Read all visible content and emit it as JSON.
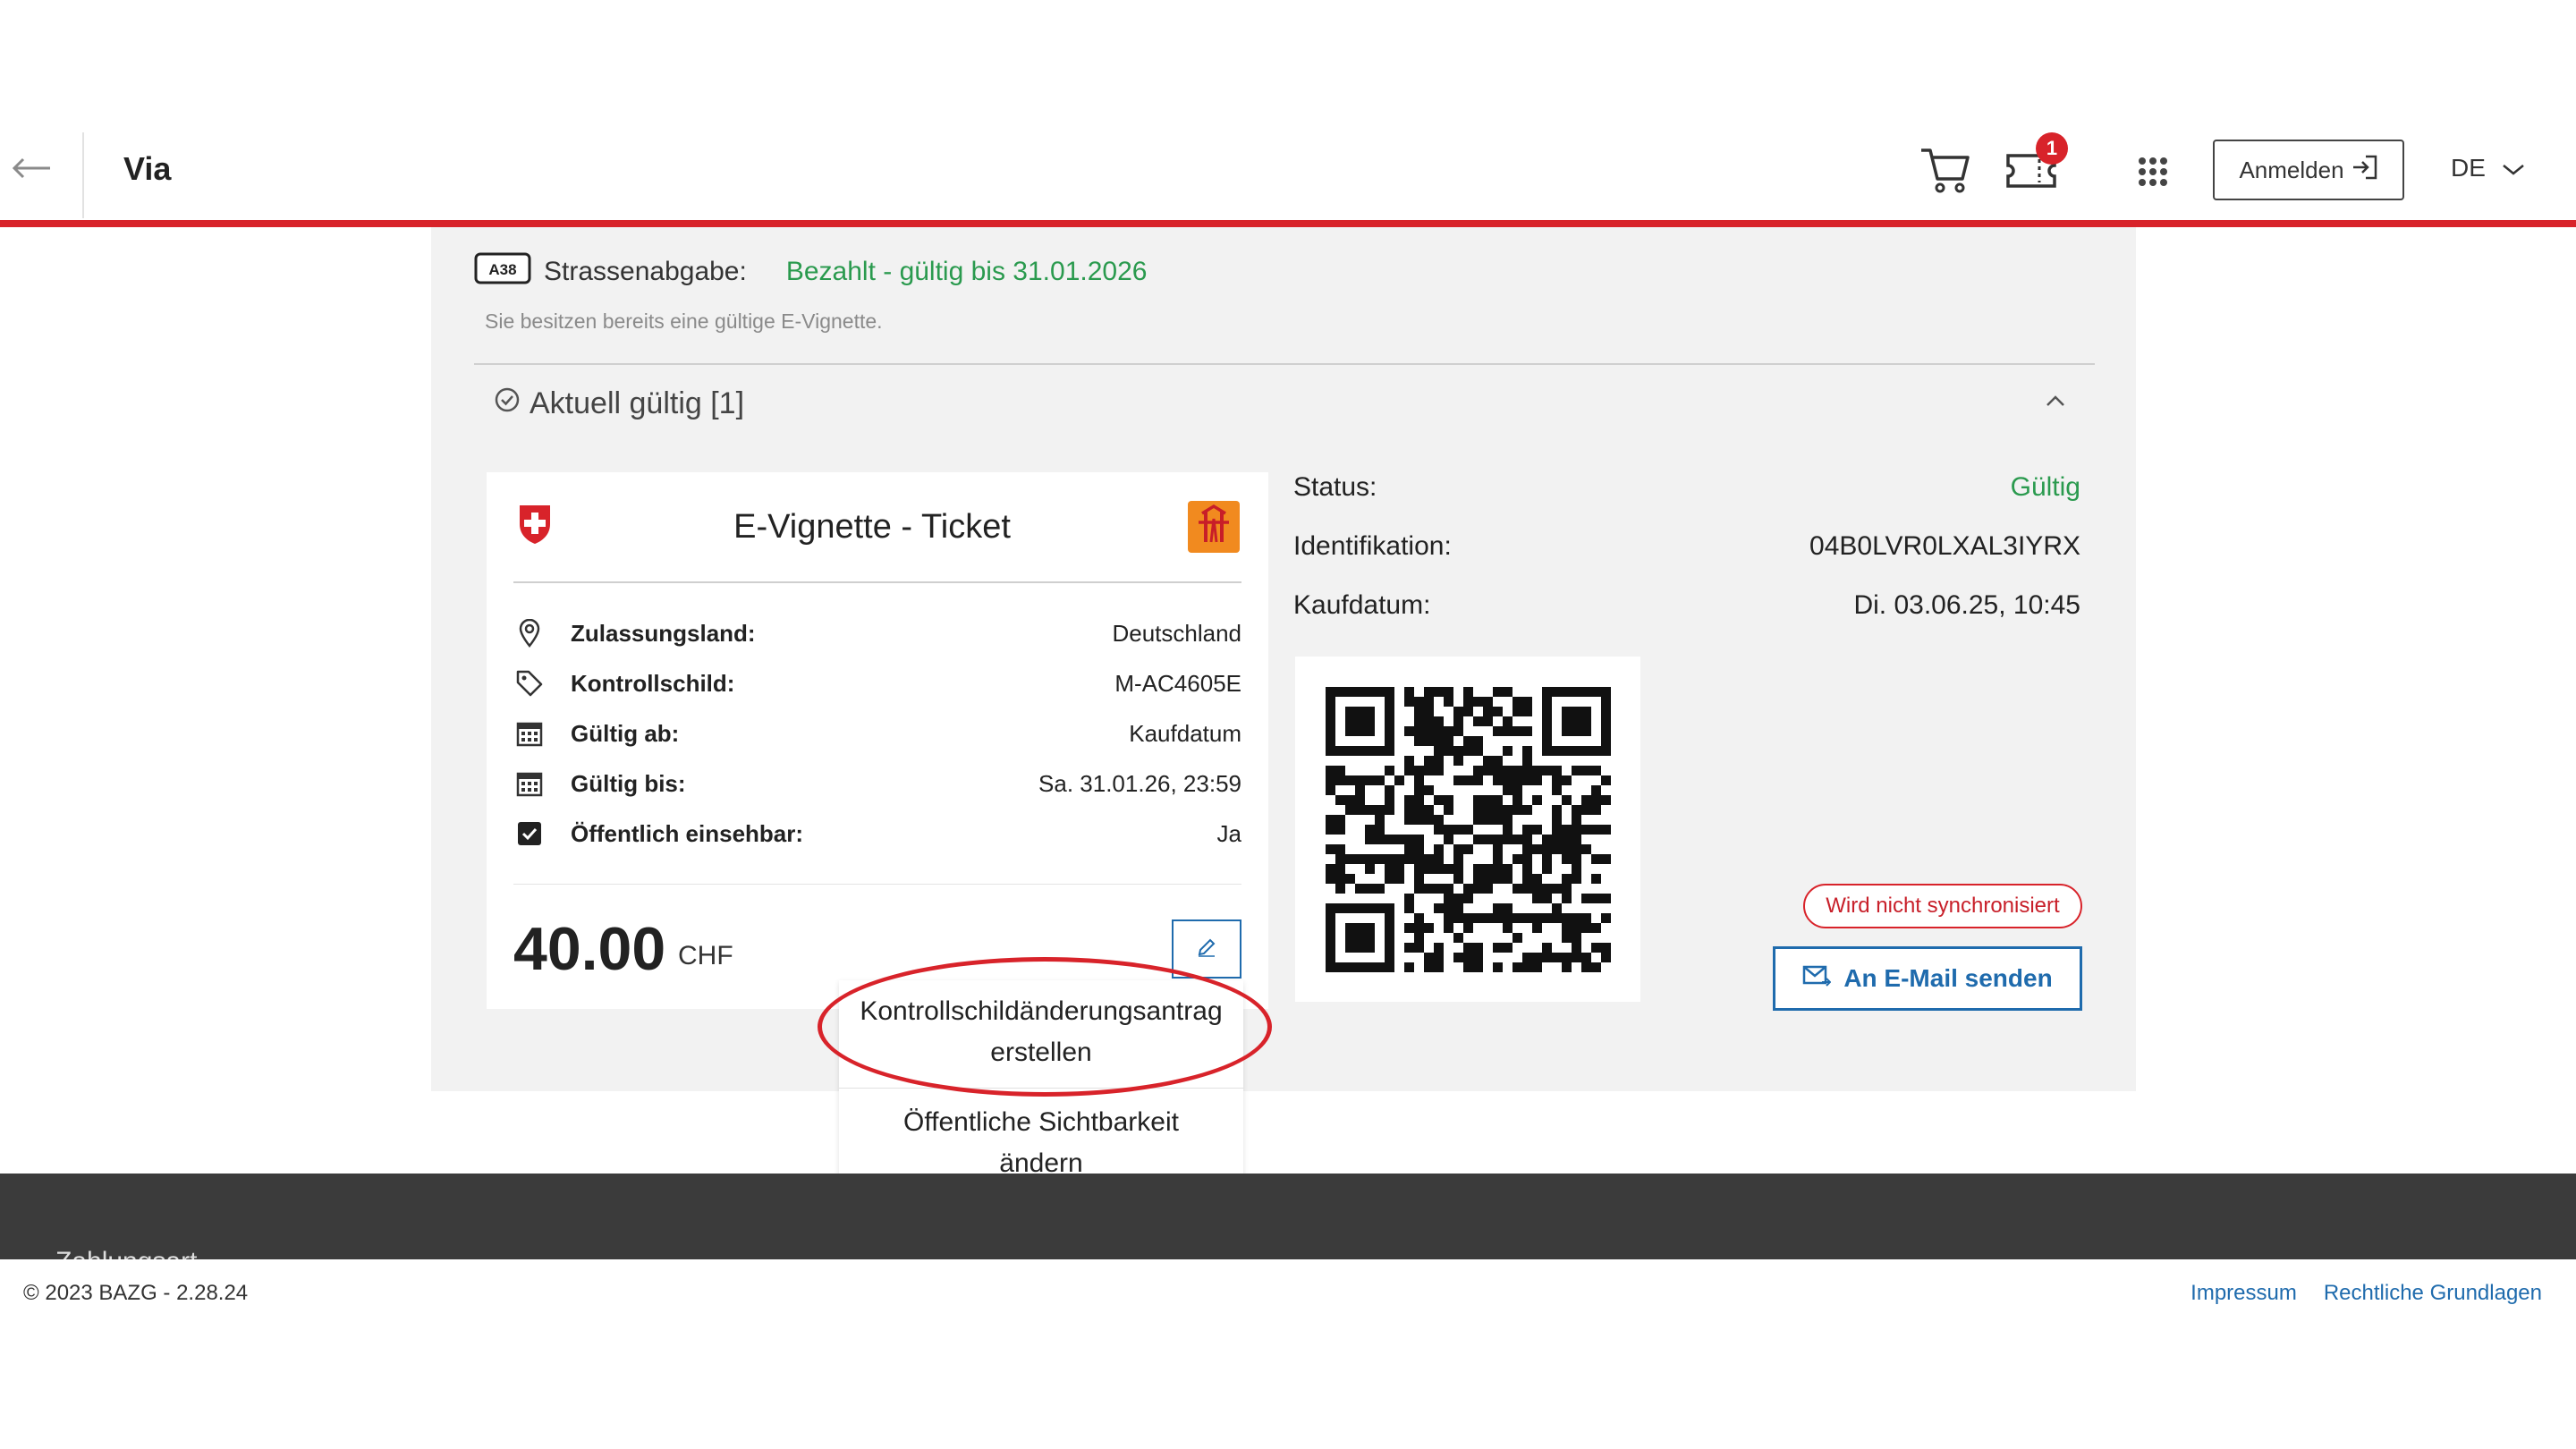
{
  "header": {
    "title": "Via",
    "cart_badge": "1",
    "login_label": "Anmelden",
    "language": "DE"
  },
  "tax": {
    "label": "Strassenabgabe:",
    "status": "Bezahlt - gültig bis 31.01.2026",
    "subtext": "Sie besitzen bereits eine gültige E-Vignette.",
    "badge": "A38"
  },
  "accordion": {
    "title": "Aktuell gültig [1]"
  },
  "ticket": {
    "title": "E-Vignette - Ticket",
    "rows": [
      {
        "label": "Zulassungsland:",
        "value": "Deutschland",
        "icon": "location-pin-icon"
      },
      {
        "label": "Kontrollschild:",
        "value": "M-AC4605E",
        "icon": "tag-icon"
      },
      {
        "label": "Gültig ab:",
        "value": "Kaufdatum",
        "icon": "calendar-icon"
      },
      {
        "label": "Gültig bis:",
        "value": "Sa. 31.01.26, 23:59",
        "icon": "calendar-icon"
      },
      {
        "label": "Öffentlich einsehbar:",
        "value": "Ja",
        "icon": "checkbox-icon"
      }
    ],
    "price": "40.00",
    "currency": "CHF"
  },
  "menu": {
    "item1_line1": "Kontrollschildänderungsantrag",
    "item1_line2": "erstellen",
    "item2_line1": "Öffentliche Sichtbarkeit",
    "item2_line2": "ändern"
  },
  "details": {
    "status_label": "Status:",
    "status_value": "Gültig",
    "id_label": "Identifikation:",
    "id_value": "04B0LVR0LXAL3IYRX",
    "date_label": "Kaufdatum:",
    "date_value": "Di. 03.06.25, 10:45"
  },
  "sync_status": "Wird nicht synchronisiert",
  "email_button": "An E-Mail senden",
  "footer": {
    "dark_text": "Zahlungsart",
    "copyright": "© 2023 BAZG - 2.28.24",
    "links": [
      "Impressum",
      "Rechtliche Grundlagen"
    ]
  },
  "colors": {
    "accent_red": "#d8232a",
    "success_green": "#2a9a4e",
    "link_blue": "#1f6bad"
  }
}
